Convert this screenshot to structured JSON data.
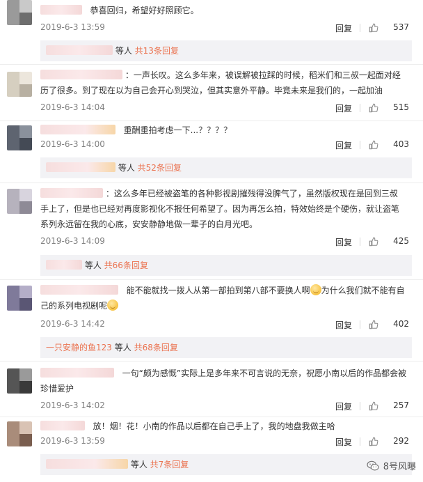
{
  "ui": {
    "reply_label": "回复",
    "others_label": "等人",
    "accent": "#eb7350",
    "sub_bg": "#f2f2f5"
  },
  "comments": [
    {
      "line1": "恭喜回归，希望好好照顾它。",
      "time": "2019-6-3 13:59",
      "likes": "537",
      "sub_count": "共13条回复"
    },
    {
      "line1": "：一声长叹。这么多年来，被误解被拉踩的时候，稻米们和三叔一起面对经",
      "line2": "历了很多。到了现在以为自己会开心到哭泣，但其实意外平静。毕竟未来是我们的，一起加油",
      "time": "2019-6-3 14:04",
      "likes": "515"
    },
    {
      "line1": "重酬重拍考虑一下...？？？？",
      "time": "2019-6-3 14:00",
      "likes": "403",
      "sub_count": "共52条回复"
    },
    {
      "line1": "：这么多年已经被盗笔的各种影视剧摧残得没脾气了，虽然版权现在是回到三叔",
      "line2": "手上了，但是也已经对再度影视化不报任何希望了。因为再怎么拍，特效始终是个硬伤，就让盗笔",
      "line3": "系列永远留在我的心底，安安静静地做一辈子的白月光吧。",
      "time": "2019-6-3 14:09",
      "likes": "425",
      "sub_count": "共66条回复"
    },
    {
      "line1a": "能不能就找一拨人从第一部拍到第八部不要换人啊",
      "line1b": "为什么我们就不能有自",
      "line2": "己的系列电视剧呢",
      "time": "2019-6-3 14:42",
      "likes": "402",
      "sub_name": "一只安静的鱼123",
      "sub_count": "共68条回复"
    },
    {
      "line1": "一句“颇为感慨”实际上是多年来不可言说的无奈，祝愿小南以后的作品都会被",
      "line2": "珍惜爱护",
      "time": "2019-6-3 14:02",
      "likes": "257"
    },
    {
      "line1": "放！烟！花！小南的作品以后都在自己手上了，我的地盘我做主哈",
      "time": "2019-6-3 13:59",
      "likes": "292",
      "sub_count": "共7条回复"
    }
  ],
  "watermark": "8号风曝",
  "colors": {
    "thumb_outline": "#888888",
    "divider": "#eeeeee"
  }
}
